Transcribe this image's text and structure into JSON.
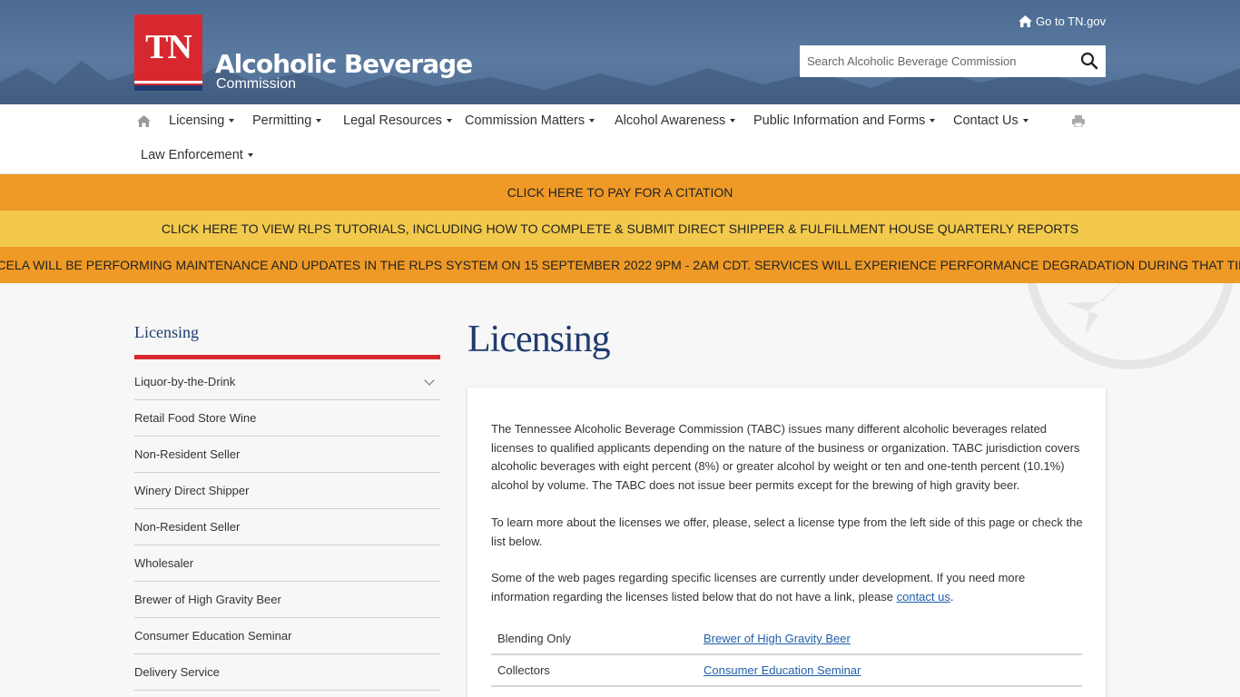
{
  "header": {
    "logo_mark": "TN",
    "logo_title": "Alcoholic Beverage",
    "logo_subtitle": "Commission",
    "goto_label": "Go to TN.gov",
    "search_placeholder": "Search Alcoholic Beverage Commission"
  },
  "nav": {
    "items": [
      {
        "label": "Licensing"
      },
      {
        "label": "Permitting"
      },
      {
        "label": "Legal Resources"
      },
      {
        "label": "Commission Matters"
      },
      {
        "label": "Alcohol Awareness"
      },
      {
        "label": "Public Information and Forms"
      },
      {
        "label": "Contact Us"
      },
      {
        "label": "Law Enforcement"
      }
    ]
  },
  "banners": [
    {
      "text": "CLICK HERE TO PAY FOR A CITATION",
      "color": "#ef9a26"
    },
    {
      "text": "CLICK HERE TO VIEW RLPS TUTORIALS, INCLUDING HOW TO COMPLETE & SUBMIT DIRECT SHIPPER & FULFILLMENT HOUSE QUARTERLY REPORTS",
      "color": "#f2c94c"
    },
    {
      "text": "ACCELA WILL BE PERFORMING MAINTENANCE AND UPDATES IN THE RLPS SYSTEM ON 15 SEPTEMBER 2022 9PM - 2AM CDT. SERVICES WILL EXPERIENCE PERFORMANCE DEGRADATION DURING THAT TIME.",
      "color": "#ef9a26"
    }
  ],
  "sidebar": {
    "title": "Licensing",
    "items": [
      {
        "label": "Liquor-by-the-Drink"
      },
      {
        "label": "Retail Food Store Wine"
      },
      {
        "label": "Non-Resident Seller"
      },
      {
        "label": "Winery Direct Shipper"
      },
      {
        "label": "Non-Resident Seller"
      },
      {
        "label": "Wholesaler"
      },
      {
        "label": "Brewer of High Gravity Beer"
      },
      {
        "label": "Consumer Education Seminar"
      },
      {
        "label": "Delivery Service"
      }
    ]
  },
  "main": {
    "title": "Licensing",
    "para1": "The Tennessee Alcoholic Beverage Commission (TABC) issues many different alcoholic beverages related licenses to qualified applicants depending on the nature of the business or organization. TABC jurisdiction covers alcoholic beverages with eight percent (8%) or greater alcohol by weight or ten and one-tenth percent (10.1%) alcohol by volume. The TABC does not issue beer permits except for the brewing of high gravity beer.",
    "para2": "To learn more about the licenses we offer, please, select a license type from the left side of this page or check the list below.",
    "para3_before": "Some of the web pages regarding specific licenses are currently under development. If you need more information regarding the licenses listed below that do not have a link, please ",
    "para3_link": "contact us",
    "para3_after": ".",
    "license_rows": [
      {
        "left": "Blending Only",
        "right": "Brewer of High Gravity Beer "
      },
      {
        "left": "Collectors",
        "right": "Consumer Education Seminar "
      }
    ]
  },
  "colors": {
    "brand_red": "#d8282f",
    "brand_navy": "#1f3b6f",
    "link_blue": "#1f5fa8"
  }
}
